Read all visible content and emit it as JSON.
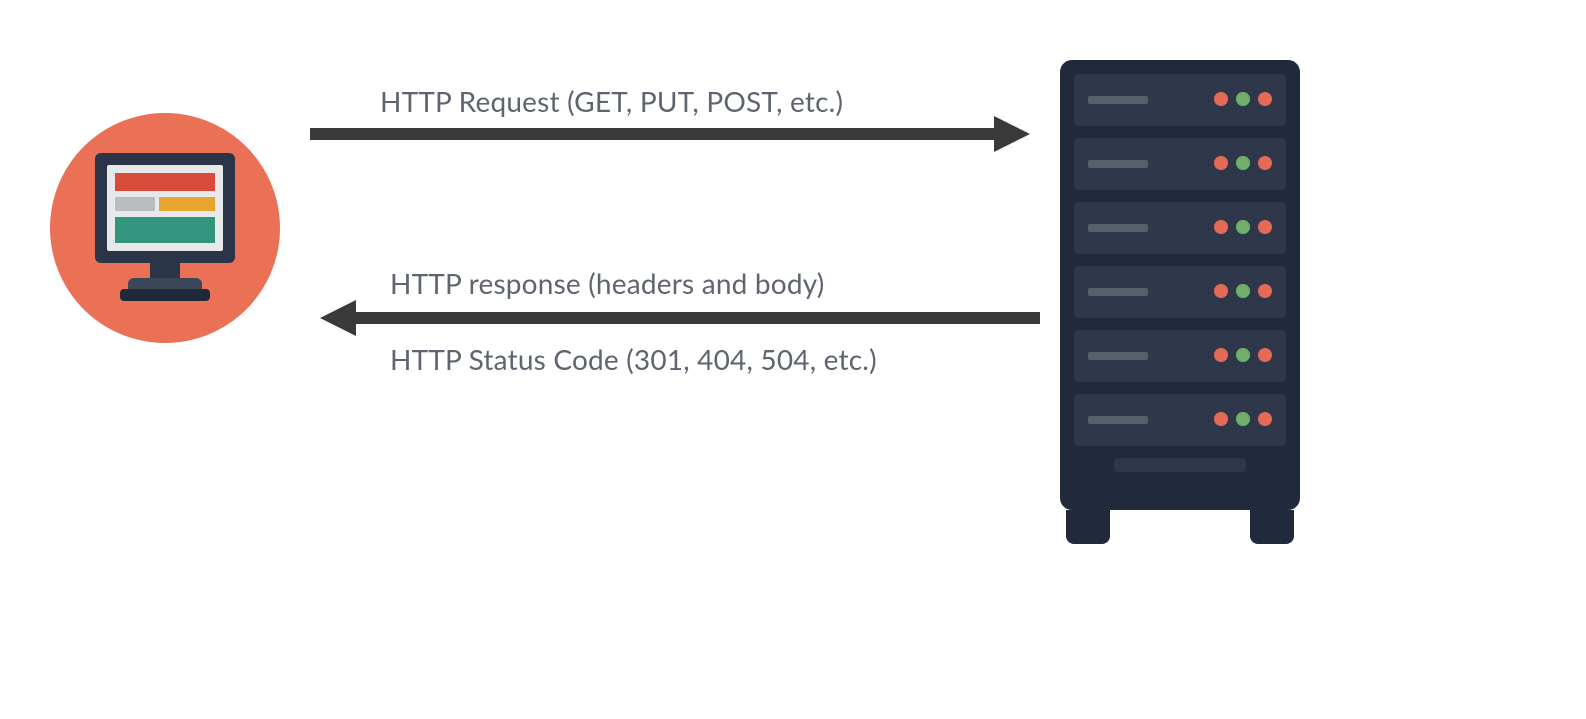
{
  "labels": {
    "request": "HTTP Request (GET,  PUT, POST, etc.)",
    "response_main": "HTTP response (headers and body)",
    "response_status": "HTTP Status Code (301, 404, 504, etc.)"
  },
  "icons": {
    "client": "desktop-computer",
    "server": "server-rack"
  },
  "colors": {
    "client_bg": "#ea7056",
    "arrow": "#3a3a3a",
    "text": "#5e6570",
    "server_body": "#202a3c",
    "led_red": "#e46a55",
    "led_green": "#71b06a"
  },
  "server": {
    "rack_count": 6,
    "led_pattern": [
      "r",
      "g",
      "r"
    ]
  }
}
